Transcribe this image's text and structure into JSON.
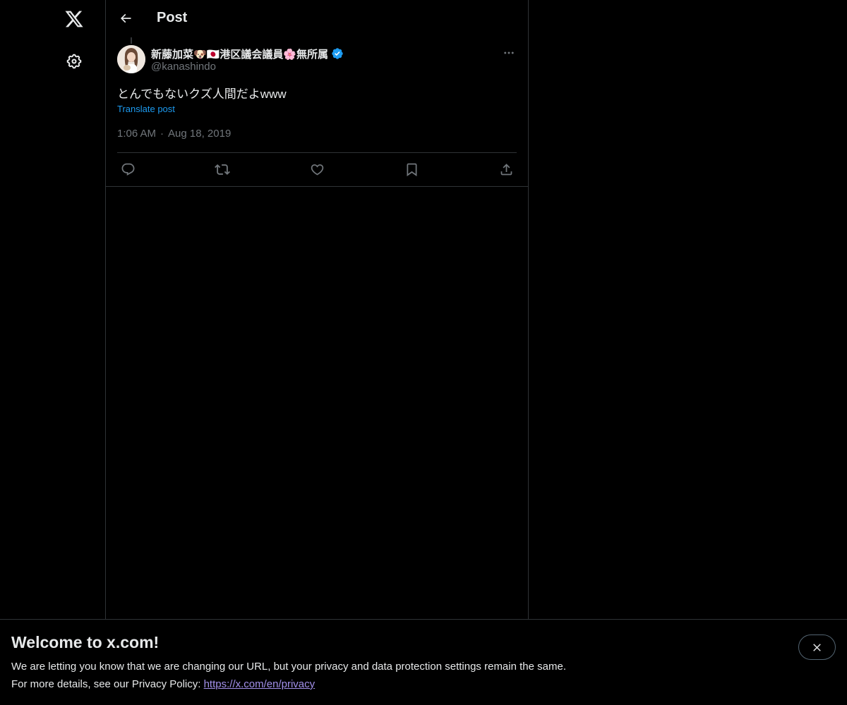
{
  "header": {
    "title": "Post"
  },
  "post": {
    "author_name": "新藤加菜🐶🇯🇵港区議会議員🌸無所属",
    "author_handle": "@kanashindo",
    "text": "とんでもないクズ人間だよwww",
    "translate_label": "Translate post",
    "time": "1:06 AM",
    "date": "Aug 18, 2019"
  },
  "banner": {
    "title": "Welcome to x.com!",
    "line1": "We are letting you know that we are changing our URL, but your privacy and data protection settings remain the same.",
    "line2_prefix": "For more details, see our Privacy Policy: ",
    "link_text": "https://x.com/en/privacy"
  },
  "icons": {
    "nav": [
      "x-logo-icon",
      "settings-gear-icon"
    ],
    "header": [
      "back-arrow-icon"
    ],
    "post": [
      "verified-badge-icon",
      "more-options-icon"
    ],
    "actions": [
      "reply-icon",
      "repost-icon",
      "like-icon",
      "bookmark-icon",
      "share-icon"
    ],
    "banner": [
      "close-icon"
    ]
  },
  "colors": {
    "background": "#000000",
    "text_primary": "#e7e9ea",
    "text_secondary": "#71767b",
    "accent": "#1d9bf0",
    "border": "#2f3336",
    "link_visited": "#a290ea"
  }
}
